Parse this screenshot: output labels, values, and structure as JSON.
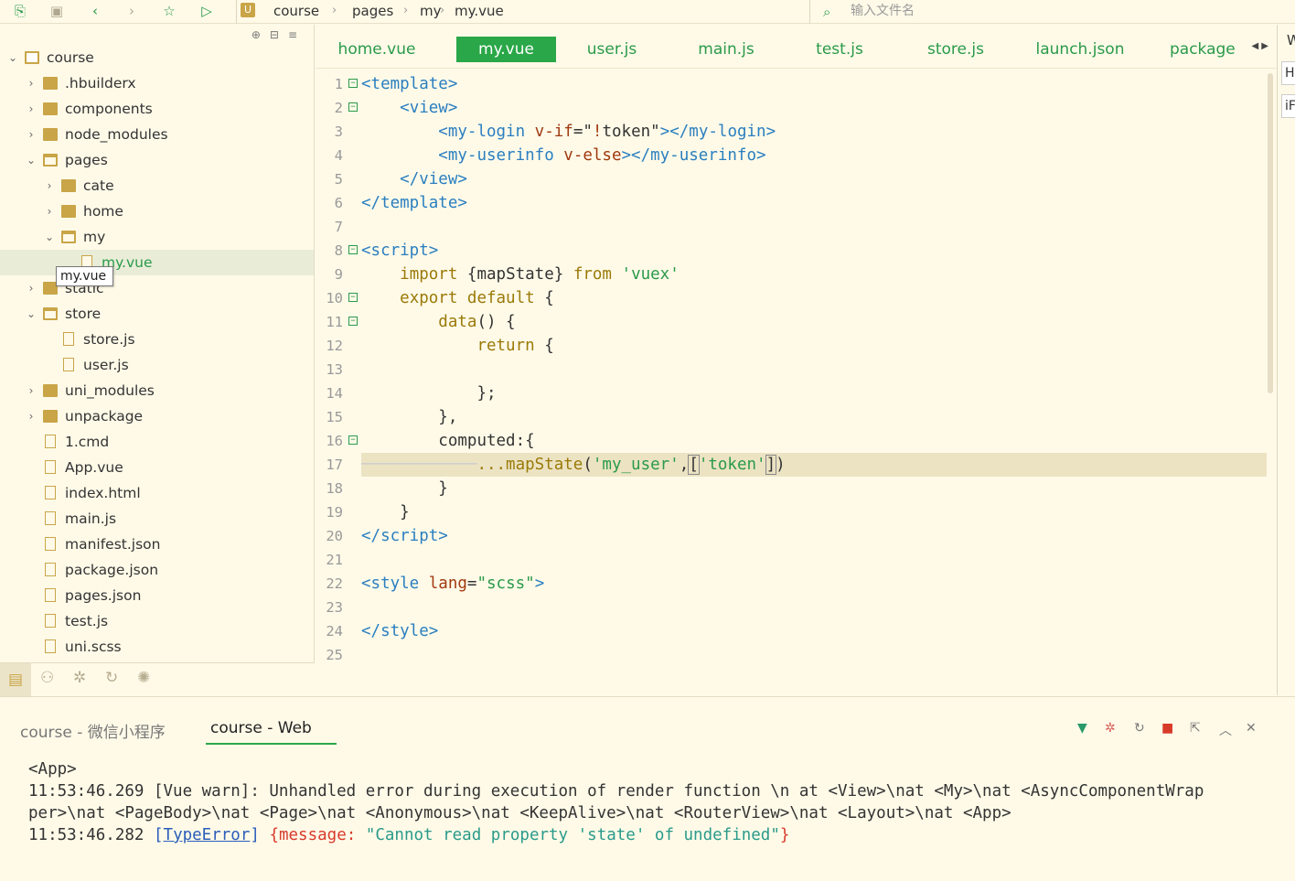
{
  "toolbar": {
    "icons": [
      "new-file-icon",
      "save-icon",
      "back-icon",
      "forward-icon",
      "star-icon",
      "run-icon"
    ]
  },
  "breadcrumb": {
    "items": [
      "course",
      "pages",
      "my",
      "my.vue"
    ]
  },
  "search": {
    "placeholder": "输入文件名"
  },
  "sidebar": {
    "tree": [
      {
        "label": "course",
        "type": "project",
        "level": 0,
        "expanded": true
      },
      {
        "label": ".hbuilderx",
        "type": "folder",
        "level": 1,
        "expanded": false
      },
      {
        "label": "components",
        "type": "folder",
        "level": 1,
        "expanded": false
      },
      {
        "label": "node_modules",
        "type": "folder",
        "level": 1,
        "expanded": false
      },
      {
        "label": "pages",
        "type": "folder",
        "level": 1,
        "expanded": true
      },
      {
        "label": "cate",
        "type": "folder",
        "level": 2,
        "expanded": false
      },
      {
        "label": "home",
        "type": "folder",
        "level": 2,
        "expanded": false
      },
      {
        "label": "my",
        "type": "folder",
        "level": 2,
        "expanded": true
      },
      {
        "label": "my.vue",
        "type": "vue",
        "level": 3,
        "selected": true
      },
      {
        "label": "static",
        "type": "folder",
        "level": 1,
        "expanded": false
      },
      {
        "label": "store",
        "type": "folder",
        "level": 1,
        "expanded": true
      },
      {
        "label": "store.js",
        "type": "js",
        "level": 2
      },
      {
        "label": "user.js",
        "type": "js",
        "level": 2
      },
      {
        "label": "uni_modules",
        "type": "folder",
        "level": 1,
        "expanded": false
      },
      {
        "label": "unpackage",
        "type": "folder",
        "level": 1,
        "expanded": false
      },
      {
        "label": "1.cmd",
        "type": "file",
        "level": 1
      },
      {
        "label": "App.vue",
        "type": "vue",
        "level": 1
      },
      {
        "label": "index.html",
        "type": "html",
        "level": 1
      },
      {
        "label": "main.js",
        "type": "js",
        "level": 1
      },
      {
        "label": "manifest.json",
        "type": "manifest",
        "level": 1
      },
      {
        "label": "package.json",
        "type": "json",
        "level": 1
      },
      {
        "label": "pages.json",
        "type": "json",
        "level": 1
      },
      {
        "label": "test.js",
        "type": "js",
        "level": 1
      },
      {
        "label": "uni.scss",
        "type": "scss",
        "level": 1
      }
    ],
    "tooltip": "my.vue"
  },
  "editor": {
    "tabs": [
      "home.vue",
      "my.vue",
      "user.js",
      "main.js",
      "test.js",
      "store.js",
      "launch.json",
      "package"
    ],
    "active_tab": "my.vue",
    "lines": [
      {
        "n": "1",
        "fold": true,
        "html": "<span class='c-tag'>&lt;template&gt;</span>"
      },
      {
        "n": "2",
        "fold": true,
        "html": "    <span class='c-tag'>&lt;view&gt;</span>"
      },
      {
        "n": "3",
        "fold": false,
        "html": "        <span class='c-tag'>&lt;my-login</span> <span class='c-attr'>v-if</span>=<span class='c-txt'>\"</span><span class='c-attr'>!</span><span class='c-txt'>token\"</span><span class='c-tag'>&gt;&lt;/my-login&gt;</span>"
      },
      {
        "n": "4",
        "fold": false,
        "html": "        <span class='c-tag'>&lt;my-userinfo</span> <span class='c-attr'>v-else</span><span class='c-tag'>&gt;&lt;/my-userinfo&gt;</span>"
      },
      {
        "n": "5",
        "fold": false,
        "html": "    <span class='c-tag'>&lt;/view&gt;</span>"
      },
      {
        "n": "6",
        "fold": false,
        "html": "<span class='c-tag'>&lt;/template&gt;</span>"
      },
      {
        "n": "7",
        "fold": false,
        "html": ""
      },
      {
        "n": "8",
        "fold": true,
        "html": "<span class='c-tag'>&lt;script&gt;</span>"
      },
      {
        "n": "9",
        "fold": false,
        "html": "    <span class='c-kw'>import</span> <span class='c-txt'>{mapState}</span> <span class='c-kw'>from</span> <span class='c-str'>'vuex'</span>"
      },
      {
        "n": "10",
        "fold": true,
        "html": "    <span class='c-kw'>export default</span> <span class='c-txt'>{</span>"
      },
      {
        "n": "11",
        "fold": true,
        "html": "        <span class='c-fn'>data</span><span class='c-txt'>() {</span>"
      },
      {
        "n": "12",
        "fold": false,
        "html": "            <span class='c-kw'>return</span> <span class='c-txt'>{</span>"
      },
      {
        "n": "13",
        "fold": false,
        "html": ""
      },
      {
        "n": "14",
        "fold": false,
        "html": "            <span class='c-txt'>};</span>"
      },
      {
        "n": "15",
        "fold": false,
        "html": "        <span class='c-txt'>},</span>"
      },
      {
        "n": "16",
        "fold": true,
        "html": "        <span class='c-txt'>computed:{</span>"
      },
      {
        "n": "17",
        "fold": false,
        "hl": true,
        "html": "<span class='c-guide'>────────────</span><span class='c-fn'>...mapState</span><span class='c-txt'>(</span><span class='c-str'>'my_user'</span><span class='c-txt'>,</span><span class='c-txt' style='outline:1px solid #888'>[</span><span class='c-str'>'token'</span><span class='c-txt' style='outline:1px solid #888'>]</span><span class='c-txt'>)</span>"
      },
      {
        "n": "18",
        "fold": false,
        "html": "        <span class='c-txt'>}</span>"
      },
      {
        "n": "19",
        "fold": false,
        "html": "    <span class='c-txt'>}</span>"
      },
      {
        "n": "20",
        "fold": false,
        "html": "<span class='c-tag'>&lt;/script&gt;</span>"
      },
      {
        "n": "21",
        "fold": false,
        "html": ""
      },
      {
        "n": "22",
        "fold": false,
        "html": "<span class='c-tag'>&lt;style</span> <span class='c-attr'>lang</span>=<span class='c-str'>\"scss\"</span><span class='c-tag'>&gt;</span>"
      },
      {
        "n": "23",
        "fold": false,
        "html": ""
      },
      {
        "n": "24",
        "fold": false,
        "html": "<span class='c-tag'>&lt;/style&gt;</span>"
      },
      {
        "n": "25",
        "fold": false,
        "html": ""
      }
    ]
  },
  "right_pane": {
    "letter": "W",
    "box1": "H",
    "box2": "iF"
  },
  "console": {
    "tabs": [
      "course - 微信小程序",
      "course - Web"
    ],
    "active_tab": "course - Web",
    "line1": "<App>",
    "line2": "11:53:46.269 [Vue warn]: Unhandled error during execution of render function \\n at <View>\\nat <My>\\nat <AsyncComponentWrap",
    "line3": "per>\\nat <PageBody>\\nat <Page>\\nat <Anonymous>\\nat <KeepAlive>\\nat <RouterView>\\nat <Layout>\\nat <App>",
    "line4_time": "11:53:46.282",
    "line4_type": "TypeError",
    "line4_key": "{message:",
    "line4_msg": "\"Cannot read property 'state' of undefined\"",
    "line4_end": "}"
  },
  "colors": {
    "accent": "#2aa748",
    "background": "#fffae8",
    "folder": "#c9a548"
  }
}
